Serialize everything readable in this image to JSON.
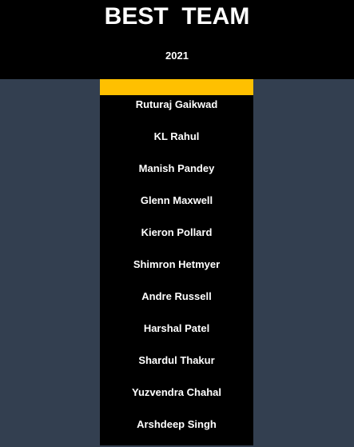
{
  "header": {
    "title": "BEST  TEAM",
    "year": "2021"
  },
  "colors": {
    "background": "#333f50",
    "panel": "#000000",
    "accent": "#ffc000",
    "text": "#ffffff"
  },
  "players": [
    "Ruturaj Gaikwad",
    "KL Rahul",
    "Manish Pandey",
    "Glenn Maxwell",
    "Kieron Pollard",
    "Shimron Hetmyer",
    "Andre Russell",
    "Harshal Patel",
    "Shardul Thakur",
    "Yuzvendra Chahal",
    "Arshdeep Singh"
  ]
}
